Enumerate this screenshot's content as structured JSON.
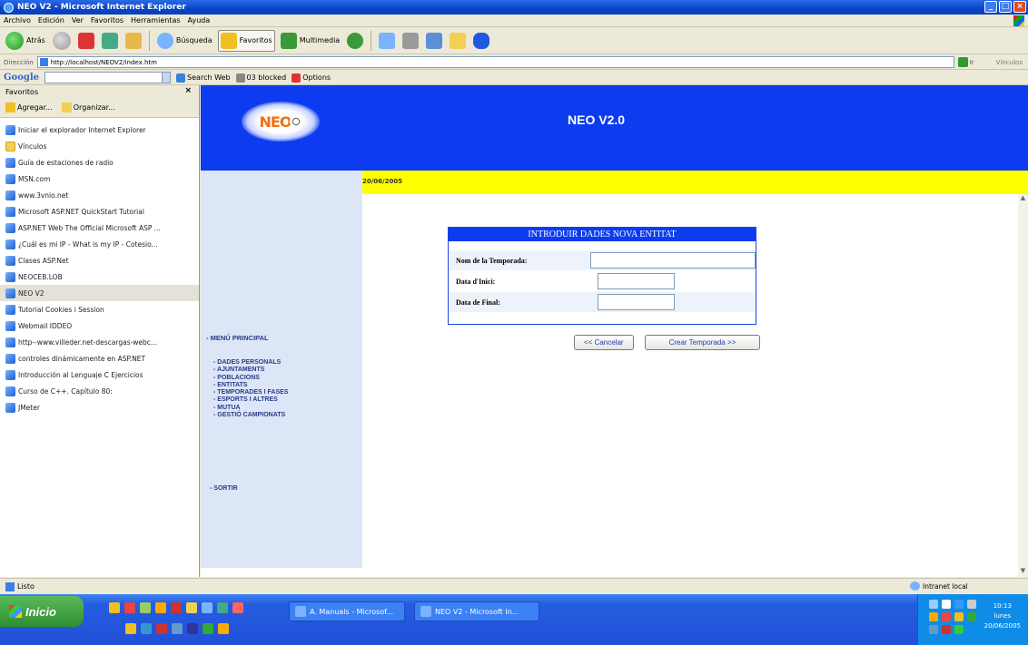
{
  "window": {
    "title": "NEO V2 - Microsoft Internet Explorer"
  },
  "menubar": {
    "items": [
      "Archivo",
      "Edición",
      "Ver",
      "Favoritos",
      "Herramientas",
      "Ayuda"
    ]
  },
  "toolbar": {
    "back": "Atrás",
    "search": "Búsqueda",
    "favorites": "Favoritos",
    "multimedia": "Multimedia"
  },
  "address": {
    "label": "Dirección",
    "url": "http://localhost/NEOV2/index.htm",
    "go": "Ir",
    "links": "Vínculos"
  },
  "googlebar": {
    "logo": "Google",
    "search_web": "Search Web",
    "blocked": "03 blocked",
    "options": "Options"
  },
  "favorites": {
    "title": "Favoritos",
    "add": "Agregar...",
    "organize": "Organizar...",
    "items": [
      {
        "label": "Iniciar el explorador Internet Explorer",
        "icon": "page-icon"
      },
      {
        "label": "Vínculos",
        "icon": "folder-icon"
      },
      {
        "label": "Guía de estaciones de radio",
        "icon": "page-icon"
      },
      {
        "label": "MSN.com",
        "icon": "page-icon"
      },
      {
        "label": "www.3vnio.net",
        "icon": "page-icon"
      },
      {
        "label": "Microsoft ASP.NET QuickStart Tutorial",
        "icon": "page-icon"
      },
      {
        "label": "ASP.NET Web The Official Microsoft ASP ...",
        "icon": "page-icon"
      },
      {
        "label": "¿Cuál es mi IP - What is my IP - Cotesio...",
        "icon": "page-icon"
      },
      {
        "label": "Clases ASP.Net",
        "icon": "page-icon"
      },
      {
        "label": "NEOCEB.LOB",
        "icon": "page-icon"
      },
      {
        "label": "NEO V2",
        "icon": "page-icon"
      },
      {
        "label": "Tutorial Cookies i Session",
        "icon": "page-icon"
      },
      {
        "label": "Webmail IDDEO",
        "icon": "page-icon"
      },
      {
        "label": "http--www.villeder.net-descargas-webc...",
        "icon": "page-icon"
      },
      {
        "label": "controles dinámicamente en ASP.NET",
        "icon": "page-icon"
      },
      {
        "label": "Introducción al Lenguaje C Ejercicios",
        "icon": "page-icon"
      },
      {
        "label": "Curso de C++. Capítulo 80:",
        "icon": "page-icon"
      },
      {
        "label": "JMeter",
        "icon": "page-icon"
      }
    ],
    "selected_index": 10
  },
  "page": {
    "logo_text": "NEO",
    "app_title": "NEO V2.0",
    "date": "20/06/2005",
    "nav": {
      "main": "- MENÚ PRINCIPAL",
      "items": [
        "- DADES PERSONALS",
        "- AJUNTAMENTS",
        "- POBLACIONS",
        "- ENTITATS",
        "- TEMPORADES I FASES",
        "- ESPORTS I ALTRES",
        "- MUTUA",
        "- GESTIÓ CAMPIONATS"
      ],
      "exit": "- SORTIR"
    },
    "form": {
      "title": "INTRODUIR DADES NOVA ENTITAT",
      "field1_label": "Nom de la Temporada:",
      "field1_value": "",
      "field2_label": "Data d'Inici:",
      "field2_value": "",
      "field3_label": "Data de Final:",
      "field3_value": "",
      "cancel": "<< Cancelar",
      "create": "Crear Temporada >>"
    }
  },
  "statusbar": {
    "text": "Listo",
    "zone": "Intranet local"
  },
  "taskbar": {
    "start": "Inicio",
    "tasks": [
      "A. Manuals - Microsof...",
      "NEO V2 - Microsoft In..."
    ],
    "time": "10:13",
    "day": "lunes",
    "date": "20/06/2005"
  }
}
